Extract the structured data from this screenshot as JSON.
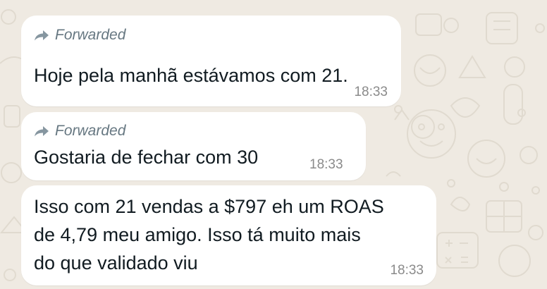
{
  "chat": {
    "messages": [
      {
        "forwarded": true,
        "forwarded_label": "Forwarded",
        "forwarded_icon": "forward-arrow-icon",
        "text": "Hoje pela manhã estávamos com 21.",
        "time": "18:33"
      },
      {
        "forwarded": true,
        "forwarded_label": "Forwarded",
        "forwarded_icon": "forward-arrow-icon",
        "text": "Gostaria de fechar com 30",
        "time": "18:33"
      },
      {
        "forwarded": false,
        "lines": [
          "Isso com 21 vendas a $797 eh um ROAS",
          "de 4,79 meu amigo. Isso tá muito mais",
          "do que validado viu"
        ],
        "time": "18:33"
      }
    ]
  },
  "colors": {
    "wallpaper": "#efeae2",
    "bubble": "#ffffff",
    "text": "#111b21",
    "meta": "#667781"
  }
}
